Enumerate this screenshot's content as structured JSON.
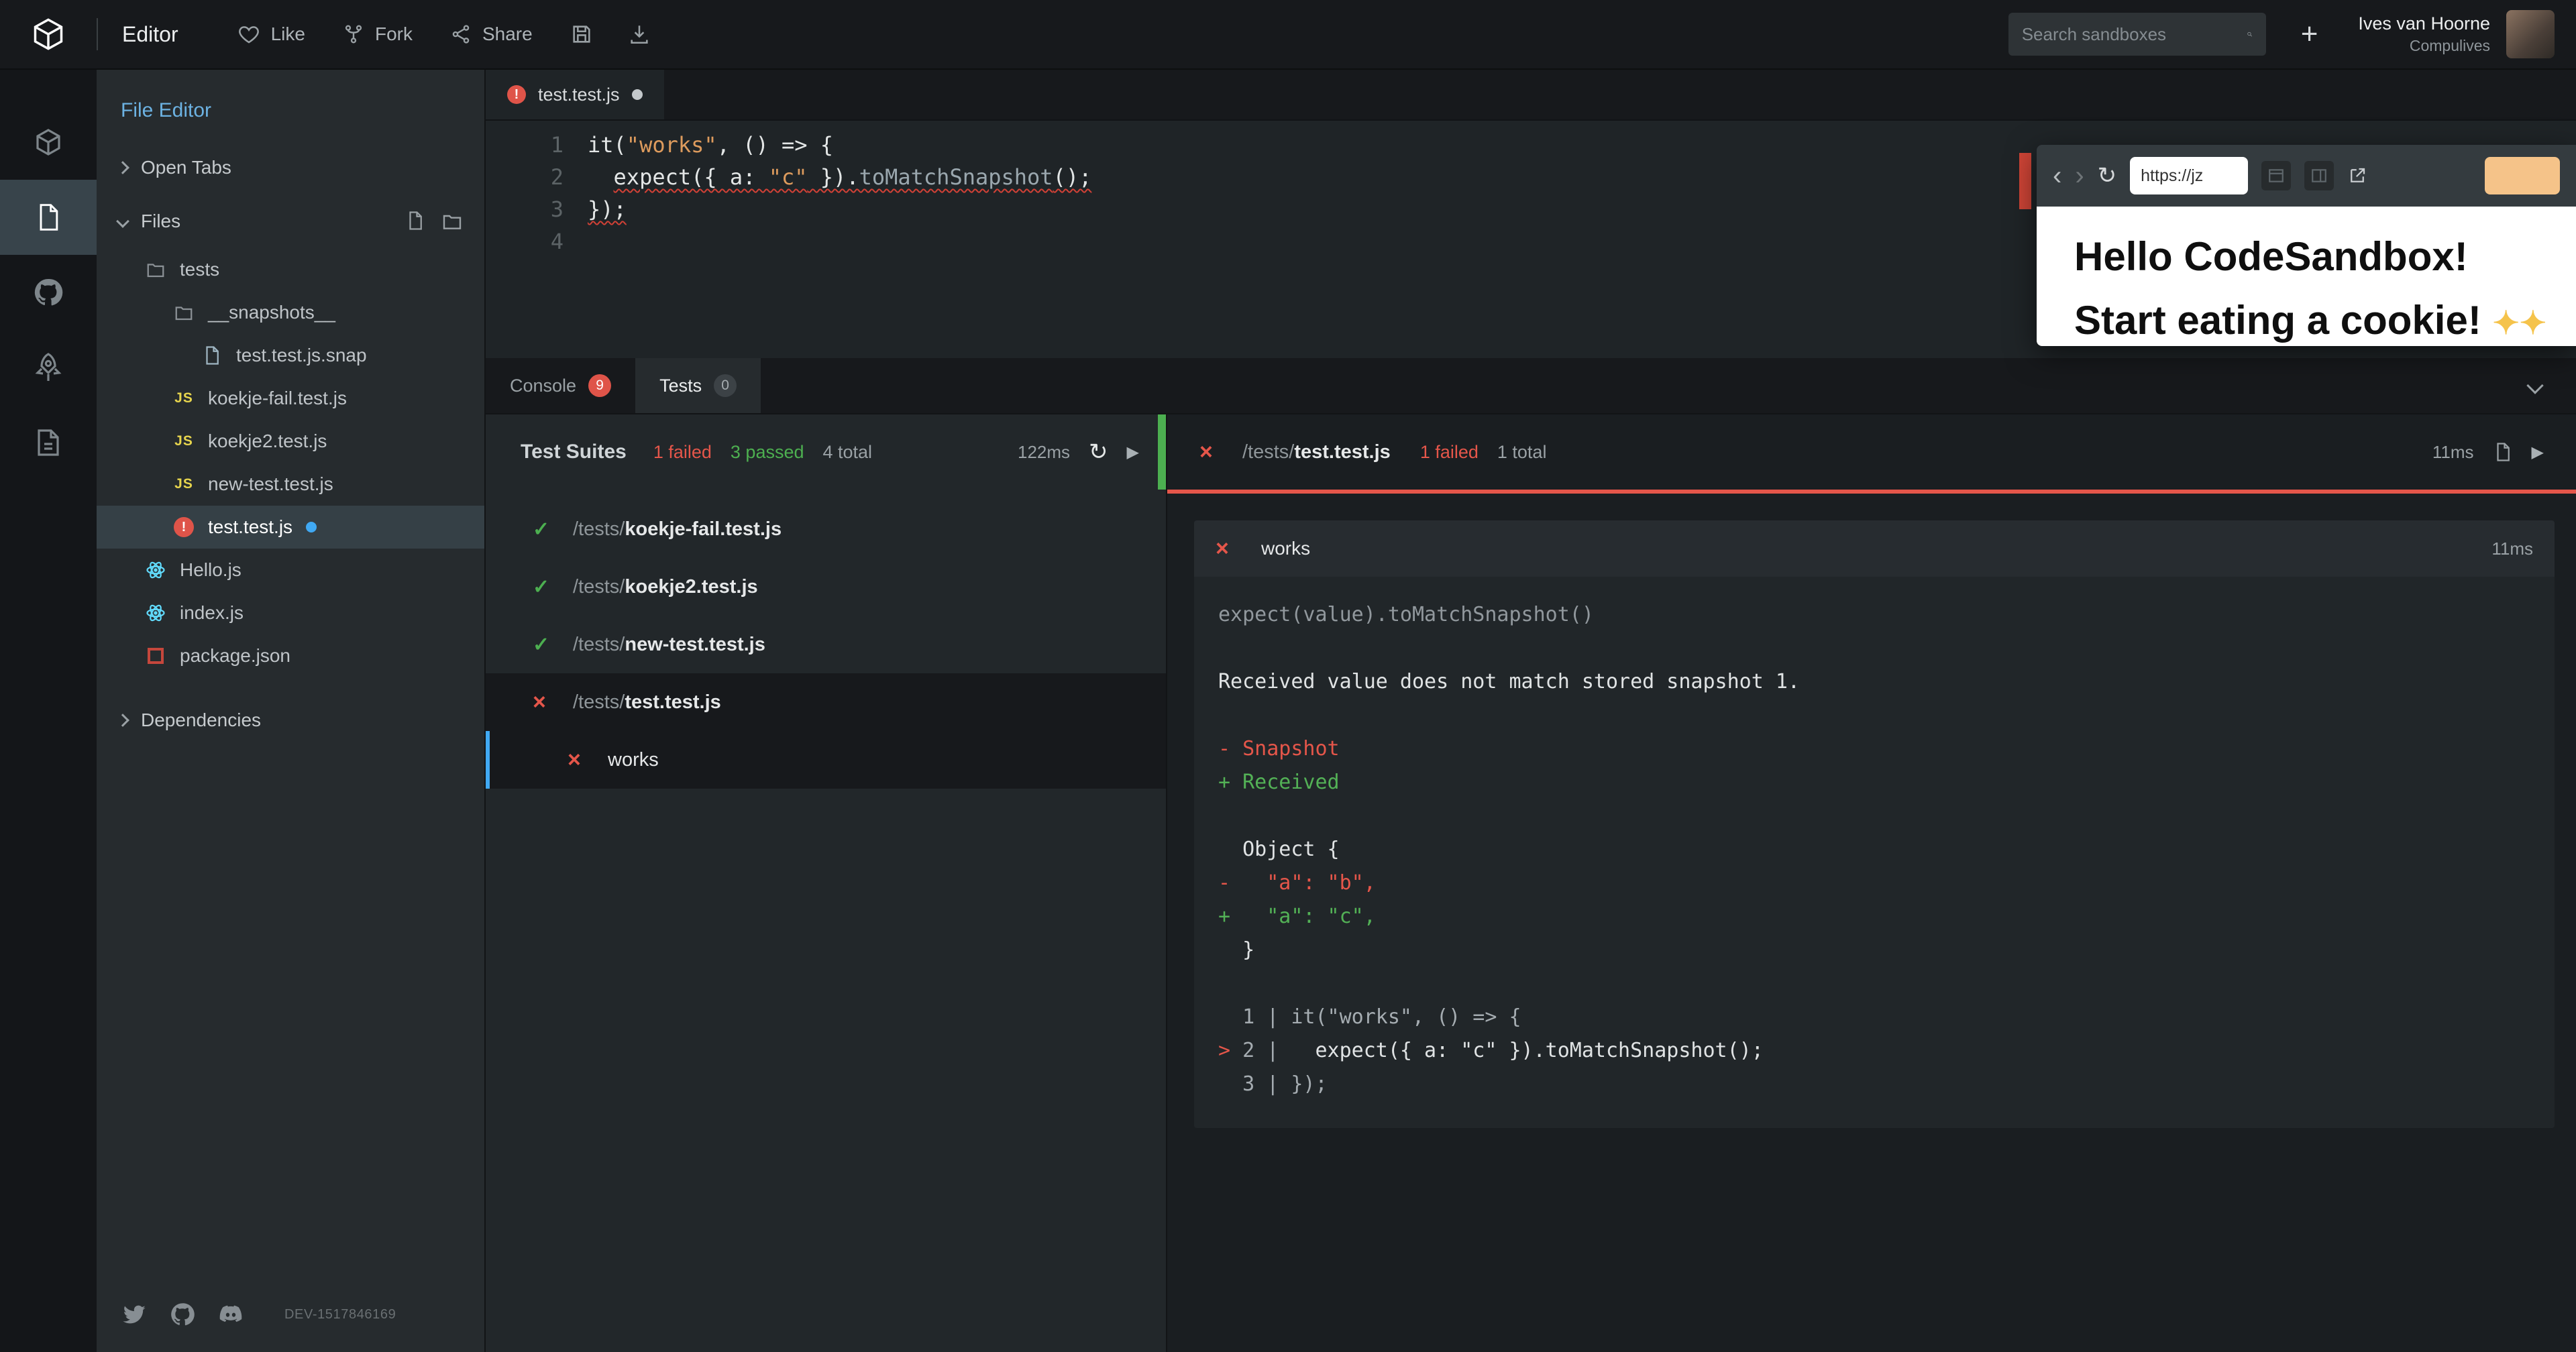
{
  "header": {
    "app_title": "Editor",
    "like_label": "Like",
    "fork_label": "Fork",
    "share_label": "Share",
    "search_placeholder": "Search sandboxes",
    "user": {
      "name": "Ives van Hoorne",
      "org": "Compulives"
    }
  },
  "sidebar": {
    "title": "File Editor",
    "open_tabs_label": "Open Tabs",
    "files_label": "Files",
    "dependencies_label": "Dependencies",
    "build_id": "DEV-1517846169",
    "tree": [
      {
        "name": "tests",
        "type": "folder",
        "depth": 1
      },
      {
        "name": "__snapshots__",
        "type": "folder",
        "depth": 2
      },
      {
        "name": "test.test.js.snap",
        "type": "file",
        "depth": 3
      },
      {
        "name": "koekje-fail.test.js",
        "type": "js",
        "depth": 2
      },
      {
        "name": "koekje2.test.js",
        "type": "js",
        "depth": 2
      },
      {
        "name": "new-test.test.js",
        "type": "js",
        "depth": 2
      },
      {
        "name": "test.test.js",
        "type": "error",
        "depth": 2,
        "selected": true,
        "modified": true
      },
      {
        "name": "Hello.js",
        "type": "react",
        "depth": 1
      },
      {
        "name": "index.js",
        "type": "react",
        "depth": 1
      },
      {
        "name": "package.json",
        "type": "npm",
        "depth": 1
      }
    ]
  },
  "editor": {
    "tab_name": "test.test.js",
    "lines": [
      [
        {
          "t": "it(",
          "c": "fg"
        },
        {
          "t": "\"works\"",
          "c": "str"
        },
        {
          "t": ", () => {",
          "c": "fg"
        }
      ],
      [
        {
          "t": "  ",
          "c": "fg"
        },
        {
          "t": "expect({ a: ",
          "c": "fg",
          "u": true
        },
        {
          "t": "\"c\"",
          "c": "str",
          "u": true
        },
        {
          "t": " }).",
          "c": "fg",
          "u": true
        },
        {
          "t": "toMatchSnapshot",
          "c": "meth",
          "u": true
        },
        {
          "t": "();",
          "c": "fg",
          "u": true
        }
      ],
      [
        {
          "t": "});",
          "c": "fg",
          "u": true
        }
      ],
      []
    ]
  },
  "preview": {
    "url": "https://jz",
    "heading": "Hello CodeSandbox!",
    "subheading": "Start eating a cookie!",
    "sparkle": "✦✦"
  },
  "panel": {
    "tabs": {
      "console_label": "Console",
      "console_badge": "9",
      "tests_label": "Tests",
      "tests_badge": "0"
    },
    "suites": {
      "title": "Test Suites",
      "failed": "1 failed",
      "passed": "3 passed",
      "total": "4 total",
      "time": "122ms",
      "items": [
        {
          "status": "pass",
          "prefix": "/tests/",
          "name": "koekje-fail.test.js"
        },
        {
          "status": "pass",
          "prefix": "/tests/",
          "name": "koekje2.test.js"
        },
        {
          "status": "pass",
          "prefix": "/tests/",
          "name": "new-test.test.js"
        },
        {
          "status": "fail",
          "prefix": "/tests/",
          "name": "test.test.js",
          "selected": true
        },
        {
          "status": "fail",
          "prefix": "",
          "name": "works",
          "child": true,
          "selected": true,
          "active": true
        }
      ]
    },
    "detail": {
      "prefix": "/tests/",
      "name": "test.test.js",
      "failed": "1 failed",
      "total": "1 total",
      "time": "11ms",
      "block_title": "works",
      "block_time": "11ms",
      "lines": [
        [
          {
            "t": "expect(value).toMatchSnapshot()",
            "c": "dim"
          }
        ],
        [],
        [
          {
            "t": "Received value does not match stored snapshot 1.",
            "c": "fg"
          }
        ],
        [],
        [
          {
            "t": "- Snapshot",
            "c": "red"
          }
        ],
        [
          {
            "t": "+ Received",
            "c": "green"
          }
        ],
        [],
        [
          {
            "t": "  Object {",
            "c": "fg"
          }
        ],
        [
          {
            "t": "-   \"a\": \"b\",",
            "c": "red"
          }
        ],
        [
          {
            "t": "+   \"a\": \"c\",",
            "c": "green"
          }
        ],
        [
          {
            "t": "  }",
            "c": "fg"
          }
        ],
        [],
        [
          {
            "t": "  1 | it(\"works\", () => {",
            "c": "dim2"
          }
        ],
        [
          {
            "t": "> ",
            "c": "red"
          },
          {
            "t": "2 | ",
            "c": "dim2"
          },
          {
            "t": "  expect({ a: \"c\" }).toMatchSnapshot();",
            "c": "fg"
          }
        ],
        [
          {
            "t": "  3 | });",
            "c": "dim2"
          }
        ]
      ]
    }
  },
  "colors": {
    "accent_blue": "#40A9F3",
    "error_red": "#E5564A",
    "pass_green": "#4CAF50",
    "string_orange": "#DD9B5D"
  }
}
